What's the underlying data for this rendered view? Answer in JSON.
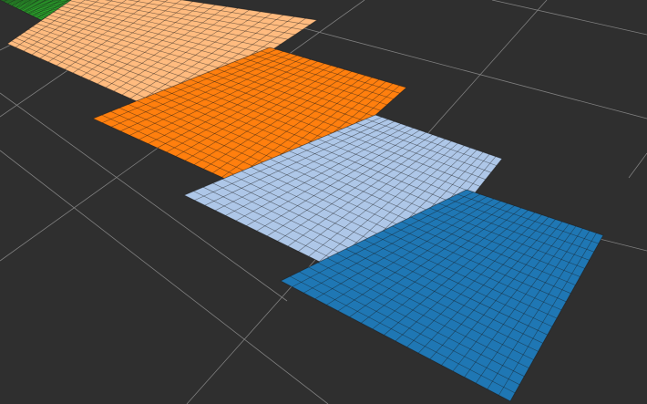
{
  "viewport": {
    "background_color": "#2f2f2f",
    "floor_grid_color": "#9a9a9a",
    "mesh_line_color": "#1a1a1a"
  },
  "planes": [
    {
      "name": "green-plane",
      "color": "#2aa12a"
    },
    {
      "name": "peach-plane",
      "color": "#ffbb7f"
    },
    {
      "name": "orange-plane",
      "color": "#ff7f0e"
    },
    {
      "name": "light-blue-plane",
      "color": "#aec7e8"
    },
    {
      "name": "blue-plane",
      "color": "#1f77b4"
    }
  ]
}
